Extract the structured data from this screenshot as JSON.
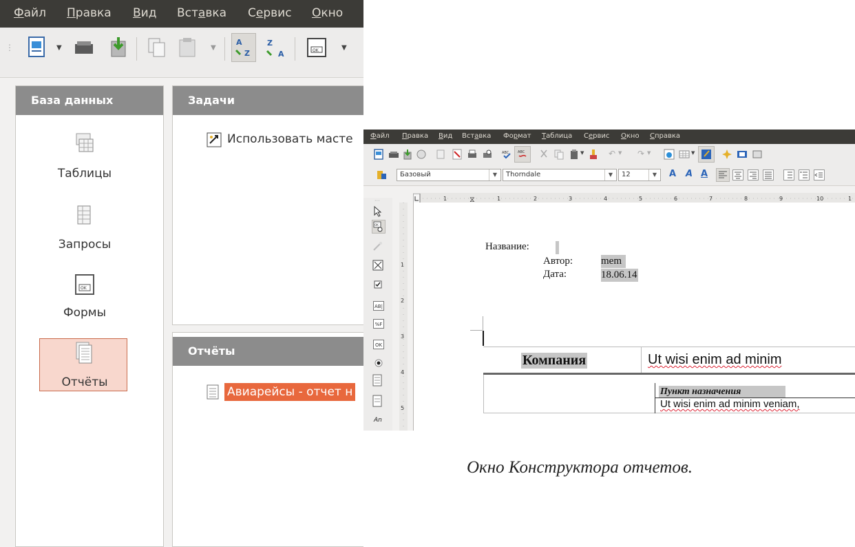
{
  "base_window": {
    "menu": [
      "Файл",
      "Правка",
      "Вид",
      "Вставка",
      "Сервис",
      "Окно"
    ],
    "database_panel": {
      "title": "База данных",
      "items": [
        {
          "label": "Таблицы",
          "icon": "table-icon"
        },
        {
          "label": "Запросы",
          "icon": "query-icon"
        },
        {
          "label": "Формы",
          "icon": "form-icon"
        },
        {
          "label": "Отчёты",
          "icon": "report-icon",
          "selected": true
        }
      ]
    },
    "tasks_panel": {
      "title": "Задачи",
      "items": [
        {
          "label": "Использовать масте",
          "icon": "wizard-icon"
        }
      ]
    },
    "reports_panel": {
      "title": "Отчёты",
      "items": [
        {
          "label": "Авиарейсы - отчет н",
          "icon": "report-file-icon",
          "selected": true
        }
      ]
    }
  },
  "writer_window": {
    "menu": [
      "Файл",
      "Правка",
      "Вид",
      "Вставка",
      "Формат",
      "Таблица",
      "Сервис",
      "Окно",
      "Справка"
    ],
    "style_value": "Базовый",
    "font_value": "Thorndale",
    "size_value": "12",
    "ruler_numbers": [
      "1",
      "1",
      "2",
      "3",
      "4",
      "5",
      "6",
      "7",
      "8",
      "9",
      "10",
      "1"
    ],
    "vruler_numbers": [
      "1",
      "2",
      "3",
      "4",
      "5"
    ],
    "document": {
      "title_label": "Название:",
      "author_label": "Автор:",
      "author_value": "mem",
      "date_label": "Дата:",
      "date_value": "18.06.14",
      "company_header": "Компания",
      "company_value": "Ut wisi enim ad minim",
      "destination_header": "Пункт назначения",
      "destination_value": "Ut wisi enim ad minim veniam,"
    }
  },
  "caption": "Окно Конструктора отчетов.",
  "colors": {
    "menubar_bg": "#3c3b37",
    "panel_header": "#8c8c8c",
    "selection_orange": "#e8683d",
    "selected_item_bg": "#f8d7cd"
  }
}
